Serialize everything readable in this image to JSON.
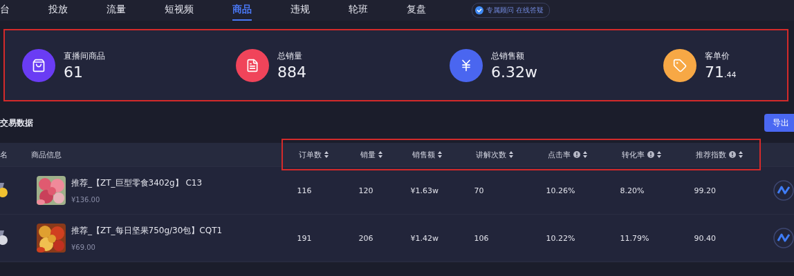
{
  "nav": {
    "tabs": [
      {
        "label": "台",
        "selected": false
      },
      {
        "label": "投放",
        "selected": false
      },
      {
        "label": "流量",
        "selected": false
      },
      {
        "label": "短视频",
        "selected": false
      },
      {
        "label": "商品",
        "selected": true
      },
      {
        "label": "违规",
        "selected": false
      },
      {
        "label": "轮班",
        "selected": false
      },
      {
        "label": "复盘",
        "selected": false
      }
    ],
    "advisor_badge": "专属顾问 在线答疑"
  },
  "stats": [
    {
      "kind": "bag",
      "label": "直播间商品",
      "value": "61",
      "color": "#6a3cf4"
    },
    {
      "kind": "note",
      "label": "总销量",
      "value": "884",
      "color": "#f0445a"
    },
    {
      "kind": "yen",
      "label": "总销售额",
      "value": "6.32w",
      "color": "#4a66f0"
    },
    {
      "kind": "tag",
      "label": "客单价",
      "value": "71",
      "value_small": ".44",
      "color": "#f7a845"
    }
  ],
  "section": {
    "title": "交易数据",
    "export_button": "导出"
  },
  "table": {
    "rank_header": "名",
    "product_header": "商品信息",
    "columns": [
      {
        "label": "订单数",
        "sortable": true,
        "info": false
      },
      {
        "label": "销量",
        "sortable": true,
        "info": false
      },
      {
        "label": "销售额",
        "sortable": true,
        "info": false
      },
      {
        "label": "讲解次数",
        "sortable": true,
        "info": false
      },
      {
        "label": "点击率",
        "sortable": true,
        "info": true
      },
      {
        "label": "转化率",
        "sortable": true,
        "info": true
      },
      {
        "label": "推荐指数",
        "sortable": true,
        "info": true
      }
    ],
    "rows": [
      {
        "color": "#f2c230",
        "name": "推荐_【ZT_巨型零食3402g】 C13",
        "price": "¥136.00",
        "cells": [
          "116",
          "120",
          "¥1.63w",
          "70",
          "10.26%",
          "8.20%",
          "99.20"
        ]
      },
      {
        "color": "#d8d9e2",
        "name": "推荐_【ZT_每日坚果750g/30包】CQT1",
        "price": "¥69.00",
        "cells": [
          "191",
          "206",
          "¥1.42w",
          "106",
          "10.22%",
          "11.79%",
          "90.40"
        ]
      }
    ]
  }
}
